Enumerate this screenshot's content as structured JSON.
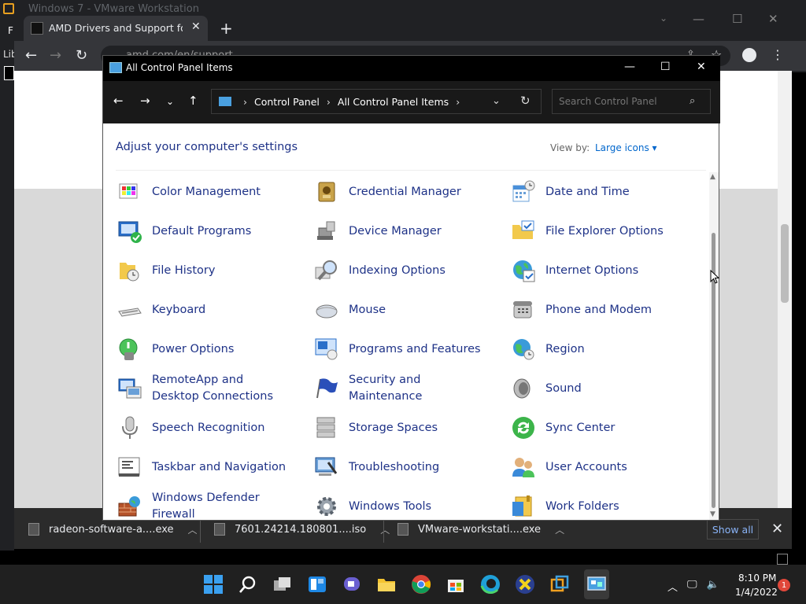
{
  "vm": {
    "title": "Windows 7 - VMware Workstation",
    "side_menu": "F",
    "side_lib": "Lib"
  },
  "browser": {
    "tab_title": "AMD Drivers and Support for Radeon",
    "new_tab": "+",
    "url": "amd.com/en/support"
  },
  "downloads": {
    "items": [
      {
        "name": "radeon-software-a....exe"
      },
      {
        "name": "7601.24214.180801....iso"
      },
      {
        "name": "VMware-workstati....exe"
      }
    ],
    "show_all": "Show all"
  },
  "control_panel": {
    "title": "All Control Panel Items",
    "breadcrumb": [
      "Control Panel",
      "All Control Panel Items"
    ],
    "search_placeholder": "Search Control Panel",
    "heading": "Adjust your computer's settings",
    "view_by_label": "View by:",
    "view_by_value": "Large icons",
    "items": [
      {
        "label": "Color Management",
        "icon": "color-management-icon"
      },
      {
        "label": "Credential Manager",
        "icon": "credential-manager-icon"
      },
      {
        "label": "Date and Time",
        "icon": "calendar-clock-icon"
      },
      {
        "label": "Default Programs",
        "icon": "default-programs-icon"
      },
      {
        "label": "Device Manager",
        "icon": "device-manager-icon"
      },
      {
        "label": "File Explorer Options",
        "icon": "folder-options-icon"
      },
      {
        "label": "File History",
        "icon": "file-history-icon"
      },
      {
        "label": "Indexing Options",
        "icon": "magnifier-icon"
      },
      {
        "label": "Internet Options",
        "icon": "globe-icon"
      },
      {
        "label": "Keyboard",
        "icon": "keyboard-icon"
      },
      {
        "label": "Mouse",
        "icon": "mouse-icon"
      },
      {
        "label": "Phone and Modem",
        "icon": "phone-icon"
      },
      {
        "label": "Power Options",
        "icon": "battery-icon"
      },
      {
        "label": "Programs and Features",
        "icon": "programs-icon"
      },
      {
        "label": "Region",
        "icon": "region-globe-icon"
      },
      {
        "label": "RemoteApp and Desktop Connections",
        "icon": "remote-desktop-icon"
      },
      {
        "label": "Security and Maintenance",
        "icon": "flag-icon"
      },
      {
        "label": "Sound",
        "icon": "speaker-icon"
      },
      {
        "label": "Speech Recognition",
        "icon": "microphone-icon"
      },
      {
        "label": "Storage Spaces",
        "icon": "storage-icon"
      },
      {
        "label": "Sync Center",
        "icon": "sync-icon"
      },
      {
        "label": "Taskbar and Navigation",
        "icon": "taskbar-icon"
      },
      {
        "label": "Troubleshooting",
        "icon": "troubleshoot-icon"
      },
      {
        "label": "User Accounts",
        "icon": "users-icon"
      },
      {
        "label": "Windows Defender Firewall",
        "icon": "firewall-icon"
      },
      {
        "label": "Windows Tools",
        "icon": "gear-tools-icon"
      },
      {
        "label": "Work Folders",
        "icon": "work-folders-icon"
      }
    ]
  },
  "taskbar": {
    "time": "8:10 PM",
    "date": "1/4/2022",
    "notification_count": "1"
  }
}
